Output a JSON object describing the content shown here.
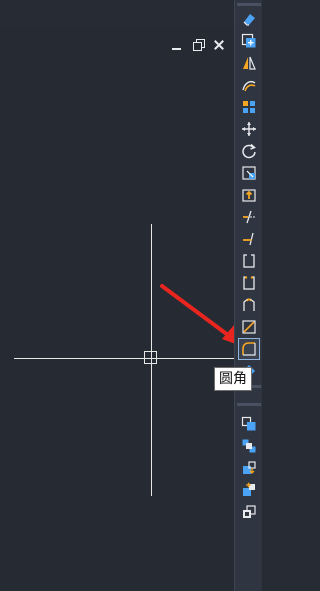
{
  "viewport": {
    "controls": [
      {
        "name": "minimize-icon"
      },
      {
        "name": "restore-icon"
      },
      {
        "name": "close-icon"
      }
    ]
  },
  "annotation": {
    "color": "#e8261f"
  },
  "tooltip": {
    "text": "圆角"
  },
  "colors": {
    "background": "#262b34",
    "toolbar": "#2f3541",
    "icon_blue": "#4ba3f5",
    "icon_orange": "#f5a623",
    "icon_white": "#e8eaed"
  },
  "toolbar": {
    "buttons": [
      {
        "name": "erase-icon"
      },
      {
        "name": "copy-icon"
      },
      {
        "name": "mirror-icon"
      },
      {
        "name": "offset-icon"
      },
      {
        "name": "array-icon"
      },
      {
        "name": "move-icon"
      },
      {
        "name": "rotate-icon"
      },
      {
        "name": "scale-icon"
      },
      {
        "name": "stretch-icon"
      },
      {
        "name": "trim-icon"
      },
      {
        "name": "extend-icon"
      },
      {
        "name": "break-at-point-icon"
      },
      {
        "name": "break-icon"
      },
      {
        "name": "join-icon"
      },
      {
        "name": "chamfer-icon"
      },
      {
        "name": "fillet-icon",
        "active": true
      },
      {
        "name": "explode-icon"
      },
      {
        "name": "draw-order-icon"
      },
      {
        "name": "bring-to-front-icon"
      },
      {
        "name": "send-to-back-icon"
      },
      {
        "name": "bring-above-icon"
      },
      {
        "name": "send-under-icon"
      }
    ]
  }
}
